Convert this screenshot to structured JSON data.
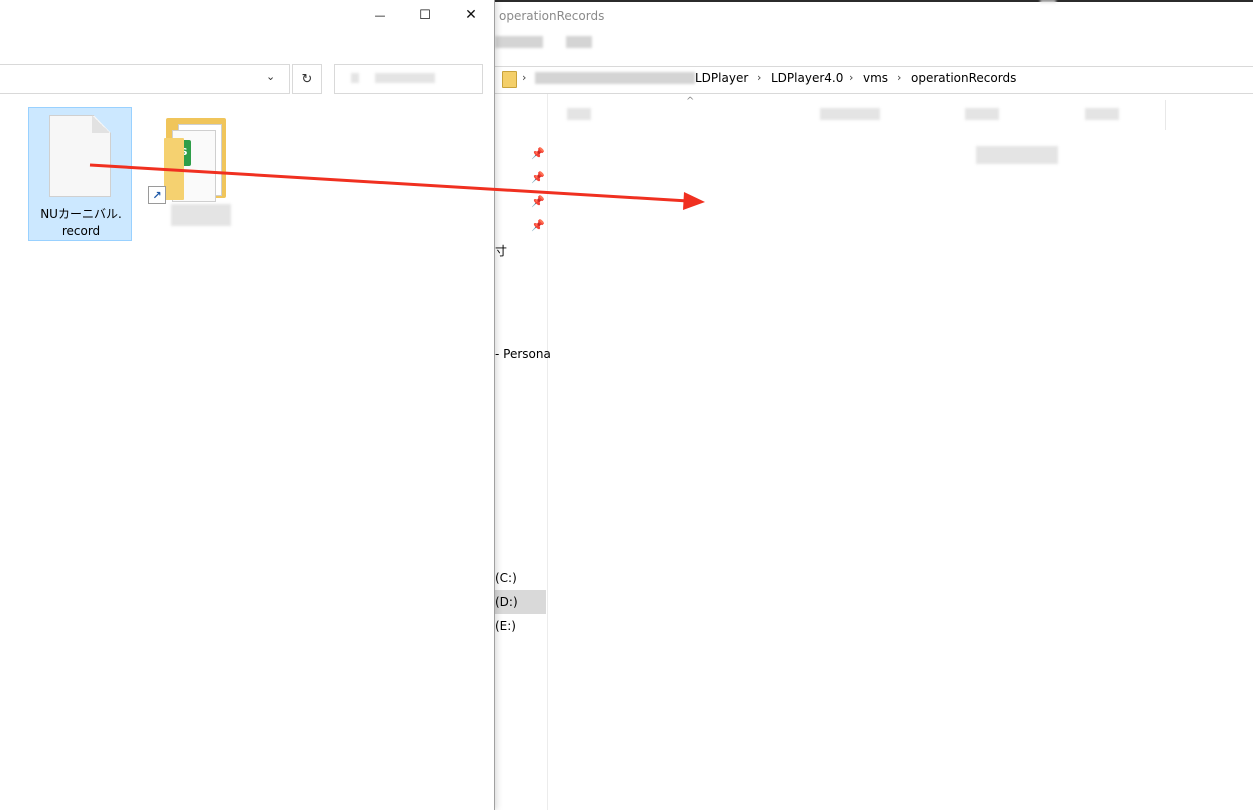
{
  "right_window": {
    "title": "operationRecords",
    "breadcrumb": [
      "LDPlayer",
      "LDPlayer4.0",
      "vms",
      "operationRecords"
    ],
    "breadcrumb_separator": "›",
    "sort_caret": "^",
    "nav_items": {
      "item_a": "寸",
      "item_personal": "- Persona",
      "drive_c": "(C:)",
      "drive_d": "(D:)",
      "drive_e": "(E:)"
    },
    "pin_icon": "📌"
  },
  "left_window": {
    "controls": {
      "minimize": "—",
      "maximize": "☐",
      "close": "✕"
    },
    "address_dropdown": "⌄",
    "refresh": "↻",
    "file": {
      "name_line1": "NUカーニバル.",
      "name_line2": "record"
    },
    "folder": {
      "badge": "S",
      "shortcut": "↗"
    }
  },
  "annotation": {
    "arrow_color": "#f03020"
  },
  "colors": {
    "selection_bg": "#cce8ff",
    "selection_border": "#99d1ff",
    "folder": "#f0c55b"
  }
}
